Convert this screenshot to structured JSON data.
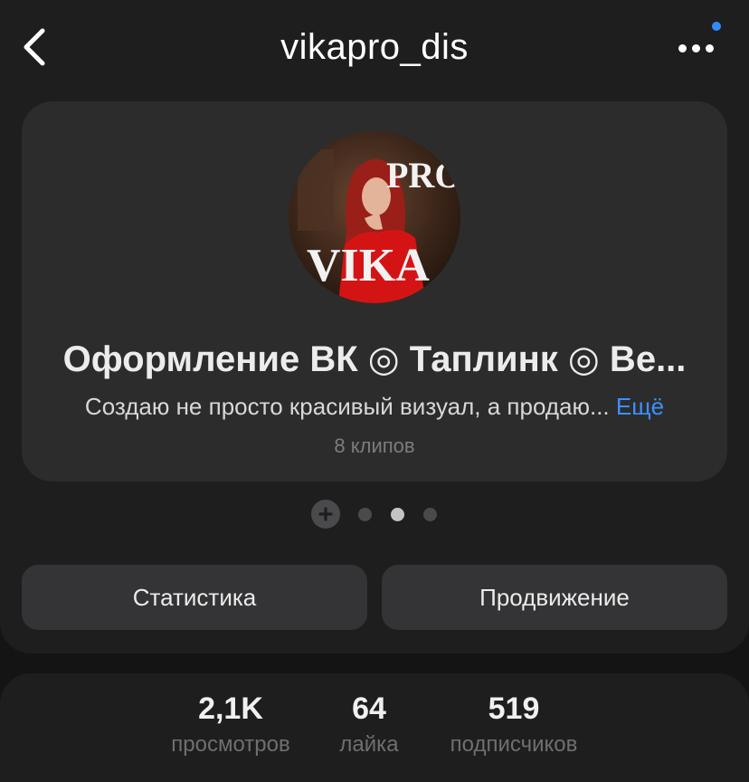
{
  "header": {
    "title": "vikapro_dis",
    "back_icon": "chevron-left-icon",
    "more_icon": "more-horizontal-icon",
    "notification_color": "#2f8cff"
  },
  "profile": {
    "avatar_text_top": "PRO",
    "avatar_text_bottom": "VIKA",
    "title": "Оформление ВК ◎ Таплинк ◎ Ве...",
    "description": "Создаю не просто красивый визуал, а продаю...",
    "more_link": "Ещё",
    "clips": "8 клипов"
  },
  "pager": {
    "add_icon": "plus-icon",
    "count": 3,
    "active_index": 1
  },
  "actions": {
    "stats_label": "Статистика",
    "promo_label": "Продвижение"
  },
  "stats": [
    {
      "value": "2,1K",
      "label": "просмотров"
    },
    {
      "value": "64",
      "label": "лайка"
    },
    {
      "value": "519",
      "label": "подписчиков"
    }
  ],
  "colors": {
    "accent": "#3d8fff",
    "background": "#141414",
    "card": "#2c2c2d"
  }
}
